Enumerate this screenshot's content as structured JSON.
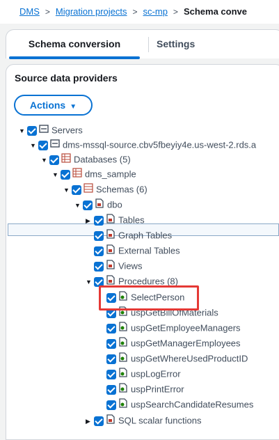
{
  "breadcrumb": {
    "items": [
      "DMS",
      "Migration projects",
      "sc-mp"
    ],
    "current": "Schema conve",
    "separator": ">"
  },
  "tabs": {
    "schema_conversion": "Schema conversion",
    "settings": "Settings"
  },
  "panel": {
    "title": "Source data providers",
    "actions_label": "Actions",
    "actions_caret": "▼"
  },
  "tree": [
    {
      "label": "Servers",
      "icon": "server-icon"
    },
    {
      "label": "dms-mssql-source.cbv5fbeyiy4e.us-west-2.rds.a",
      "icon": "server-icon"
    },
    {
      "label": "Databases (5)",
      "icon": "database-icon"
    },
    {
      "label": "dms_sample",
      "icon": "database-icon"
    },
    {
      "label": "Schemas (6)",
      "icon": "schema-icon"
    },
    {
      "label": "dbo",
      "icon": "folder-icon"
    },
    {
      "label": "Tables",
      "icon": "folder-icon"
    },
    {
      "label": "Graph Tables",
      "icon": "folder-icon"
    },
    {
      "label": "External Tables",
      "icon": "folder-icon"
    },
    {
      "label": "Views",
      "icon": "folder-icon"
    },
    {
      "label": "Procedures (8)",
      "icon": "folder-icon"
    },
    {
      "label": "SelectPerson",
      "icon": "procedure-icon"
    },
    {
      "label": "uspGetBillOfMaterials",
      "icon": "procedure-icon"
    },
    {
      "label": "uspGetEmployeeManagers",
      "icon": "procedure-icon"
    },
    {
      "label": "uspGetManagerEmployees",
      "icon": "procedure-icon"
    },
    {
      "label": "uspGetWhereUsedProductID",
      "icon": "procedure-icon"
    },
    {
      "label": "uspLogError",
      "icon": "procedure-icon"
    },
    {
      "label": "uspPrintError",
      "icon": "procedure-icon"
    },
    {
      "label": "uspSearchCandidateResumes",
      "icon": "procedure-icon"
    },
    {
      "label": "SQL scalar functions",
      "icon": "folder-icon"
    }
  ],
  "colors": {
    "accent": "#0972d3",
    "highlight": "#e53935",
    "status_ok": "#1d8102"
  }
}
